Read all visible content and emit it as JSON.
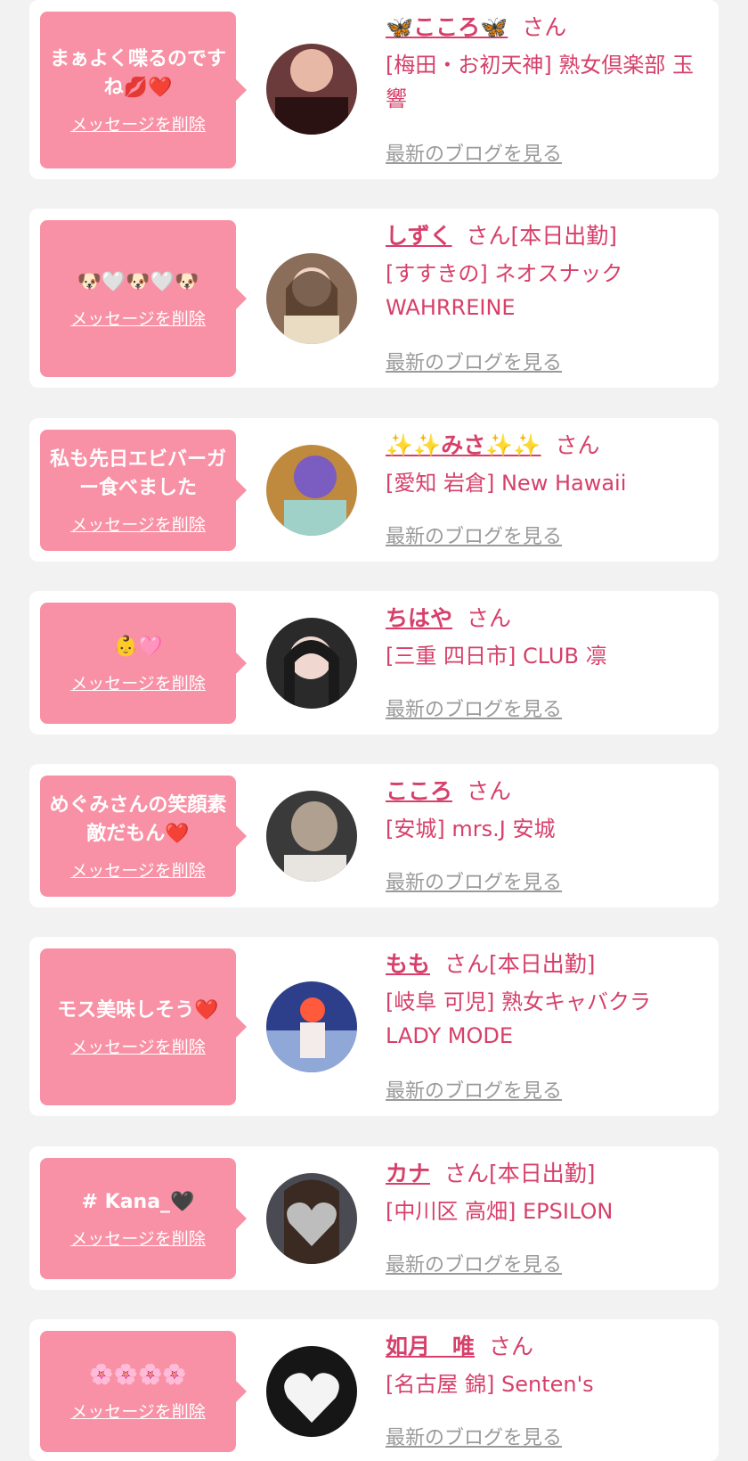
{
  "entries": [
    {
      "message": "まぁよく喋るのですね💋❤️",
      "delete_label": "メッセージを削除",
      "name": "🦋こころ🦋",
      "honorific": "さん",
      "status": "",
      "shop": "[梅田・お初天神] 熟女倶楽部 玉響",
      "blog_label": "最新のブログを見る"
    },
    {
      "message": "🐶🤍🐶🤍🐶",
      "delete_label": "メッセージを削除",
      "name": "しずく",
      "honorific": "さん",
      "status": "[本日出勤]",
      "shop": "[すすきの] ネオスナック WAHRREINE",
      "blog_label": "最新のブログを見る"
    },
    {
      "message": "私も先日エビバーガー食べました",
      "delete_label": "メッセージを削除",
      "name": "✨✨みさ✨✨",
      "honorific": "さん",
      "status": "",
      "shop": "[愛知 岩倉] New Hawaii",
      "blog_label": "最新のブログを見る"
    },
    {
      "message": "👶🩷",
      "delete_label": "メッセージを削除",
      "name": "ちはや",
      "honorific": "さん",
      "status": "",
      "shop": "[三重 四日市] CLUB 凛",
      "blog_label": "最新のブログを見る"
    },
    {
      "message": "めぐみさんの笑顔素敵だもん❤️",
      "delete_label": "メッセージを削除",
      "name": "こころ",
      "honorific": "さん",
      "status": "",
      "shop": "[安城] mrs.J 安城",
      "blog_label": "最新のブログを見る"
    },
    {
      "message": "モス美味しそう❤️",
      "delete_label": "メッセージを削除",
      "name": "もも",
      "honorific": "さん",
      "status": "[本日出勤]",
      "shop": "[岐阜 可児] 熟女キャバクラ LADY MODE",
      "blog_label": "最新のブログを見る"
    },
    {
      "message": "# Kana_🖤",
      "delete_label": "メッセージを削除",
      "name": "カナ",
      "honorific": "さん",
      "status": "[本日出勤]",
      "shop": "[中川区 高畑] EPSILON",
      "blog_label": "最新のブログを見る"
    },
    {
      "message": "🌸🌸🌸🌸",
      "delete_label": "メッセージを削除",
      "name": "如月　唯",
      "honorific": "さん",
      "status": "",
      "shop": "[名古屋 錦] Senten's",
      "blog_label": "最新のブログを見る"
    }
  ],
  "colors": {
    "background": "#f2f2f2",
    "bubble": "#f891a5",
    "accent": "#d6406a",
    "link_gray": "#9a9a9a"
  }
}
